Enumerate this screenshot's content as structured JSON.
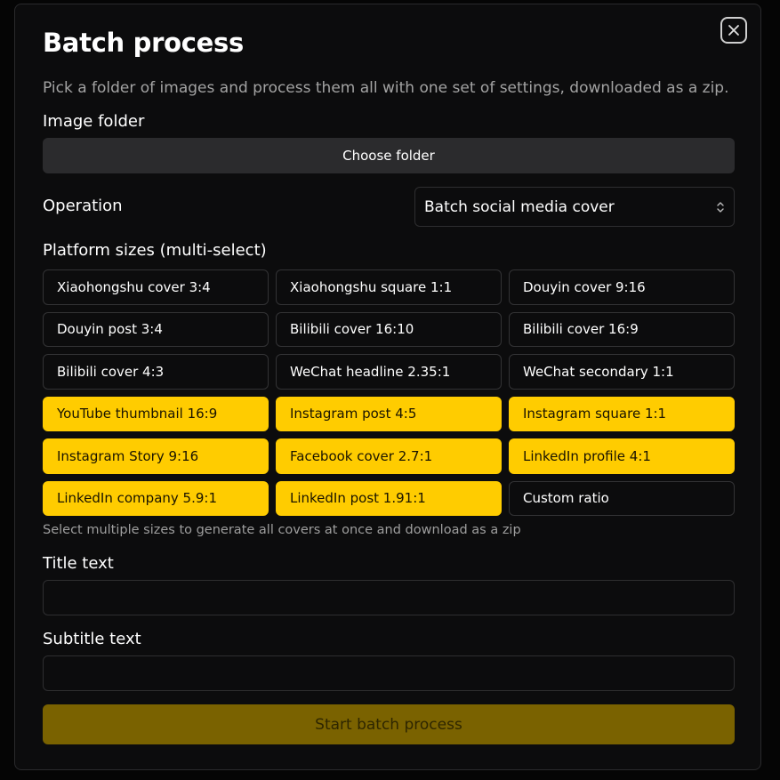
{
  "dialog": {
    "title": "Batch process",
    "description": "Pick a folder of images and process them all with one set of settings, downloaded as a zip.",
    "close_icon": "close-icon"
  },
  "folder": {
    "label": "Image folder",
    "button_label": "Choose folder"
  },
  "operation": {
    "label": "Operation",
    "selected": "Batch social media cover",
    "chevron_icon": "chevron-up-down-icon"
  },
  "platforms": {
    "label": "Platform sizes (multi-select)",
    "items": [
      {
        "label": "Xiaohongshu cover 3:4",
        "selected": false
      },
      {
        "label": "Xiaohongshu square 1:1",
        "selected": false
      },
      {
        "label": "Douyin cover 9:16",
        "selected": false
      },
      {
        "label": "Douyin post 3:4",
        "selected": false
      },
      {
        "label": "Bilibili cover 16:10",
        "selected": false
      },
      {
        "label": "Bilibili cover 16:9",
        "selected": false
      },
      {
        "label": "Bilibili cover 4:3",
        "selected": false
      },
      {
        "label": "WeChat headline 2.35:1",
        "selected": false
      },
      {
        "label": "WeChat secondary 1:1",
        "selected": false
      },
      {
        "label": "YouTube thumbnail 16:9",
        "selected": true
      },
      {
        "label": "Instagram post 4:5",
        "selected": true
      },
      {
        "label": "Instagram square 1:1",
        "selected": true
      },
      {
        "label": "Instagram Story 9:16",
        "selected": true
      },
      {
        "label": "Facebook cover 2.7:1",
        "selected": true
      },
      {
        "label": "LinkedIn profile 4:1",
        "selected": true
      },
      {
        "label": "LinkedIn company 5.9:1",
        "selected": true
      },
      {
        "label": "LinkedIn post 1.91:1",
        "selected": true
      },
      {
        "label": "Custom ratio",
        "selected": false
      }
    ],
    "hint": "Select multiple sizes to generate all covers at once and download as a zip"
  },
  "title_text": {
    "label": "Title text",
    "value": "",
    "placeholder": ""
  },
  "subtitle_text": {
    "label": "Subtitle text",
    "value": "",
    "placeholder": ""
  },
  "start_button": {
    "label": "Start batch process"
  },
  "colors": {
    "accent": "#ffcc00",
    "accent_disabled": "#7a6200",
    "background": "#0c0c0d"
  }
}
